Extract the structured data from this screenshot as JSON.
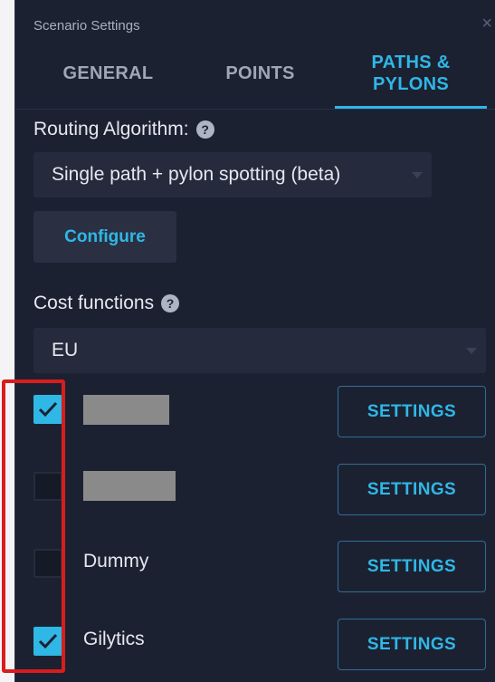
{
  "window": {
    "title": "Scenario Settings",
    "close_label": "×"
  },
  "tabs": [
    {
      "label": "GENERAL",
      "active": false
    },
    {
      "label": "POINTS",
      "active": false
    },
    {
      "label": "PATHS &",
      "label2": "PYLONS",
      "active": true
    }
  ],
  "routing": {
    "label": "Routing Algorithm:",
    "selected": "Single path + pylon spotting (beta)",
    "configure_label": "Configure"
  },
  "cost": {
    "label": "Cost functions",
    "selected": "EU",
    "items": [
      {
        "label": "",
        "checked": true,
        "redacted": true,
        "settings_label": "SETTINGS"
      },
      {
        "label": "",
        "checked": false,
        "redacted": true,
        "settings_label": "SETTINGS"
      },
      {
        "label": "Dummy",
        "checked": false,
        "redacted": false,
        "settings_label": "SETTINGS"
      },
      {
        "label": "Gilytics",
        "checked": true,
        "redacted": false,
        "settings_label": "SETTINGS"
      }
    ]
  },
  "help_icon_glyph": "?",
  "colors": {
    "accent": "#2fb7e6",
    "panel": "#1c2132",
    "highlight": "#d91c1c"
  }
}
